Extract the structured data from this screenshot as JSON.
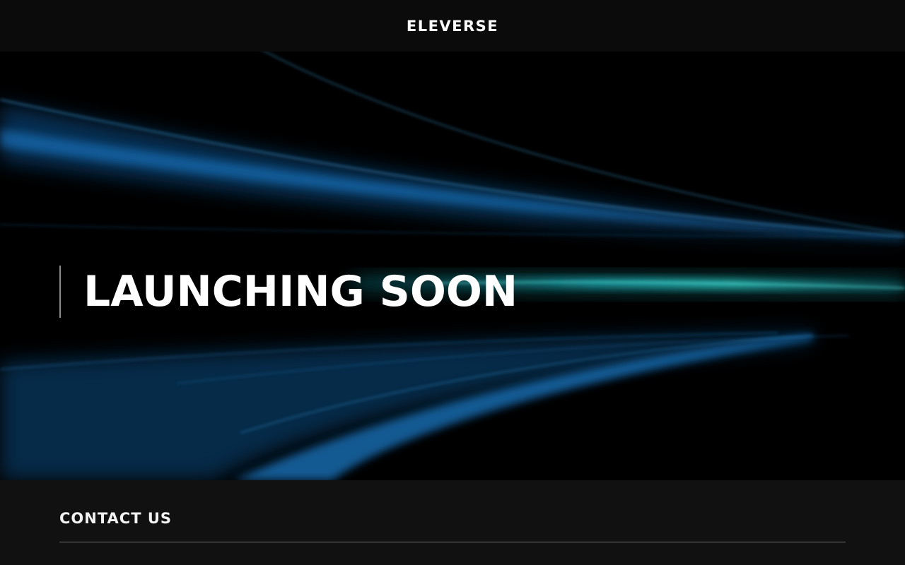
{
  "header": {
    "brand": "ELEVERSE"
  },
  "hero": {
    "heading": "LAUNCHING SOON"
  },
  "footer": {
    "title": "CONTACT US"
  },
  "colors": {
    "background": "#000000",
    "header_bg": "#0b0b0b",
    "footer_bg": "#111111",
    "light_streak_blue": "#1a7fd0",
    "light_streak_cyan": "#22d6d0"
  }
}
